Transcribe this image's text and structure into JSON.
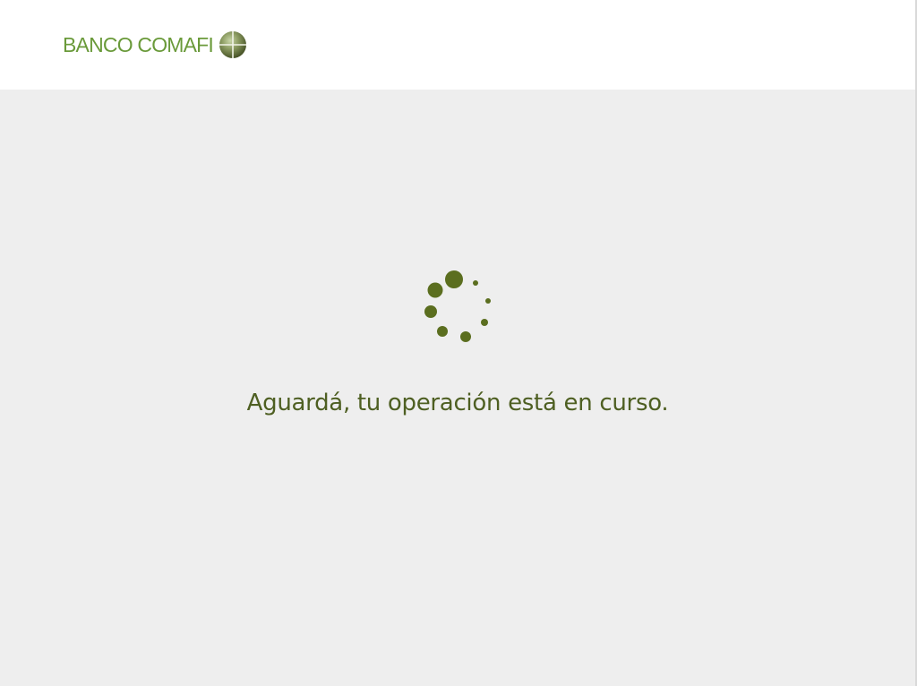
{
  "header": {
    "logo_text": "BANCO COMAFI",
    "logo_icon": "globe-icon"
  },
  "main": {
    "loading_indicator": "spinner-icon",
    "message": "Aguardá, tu operación está en curso."
  },
  "colors": {
    "brand_green": "#6a9a3a",
    "spinner_green": "#5b6e1f",
    "message_text": "#4e5f22",
    "page_background": "#eeeeee",
    "header_background": "#ffffff"
  }
}
